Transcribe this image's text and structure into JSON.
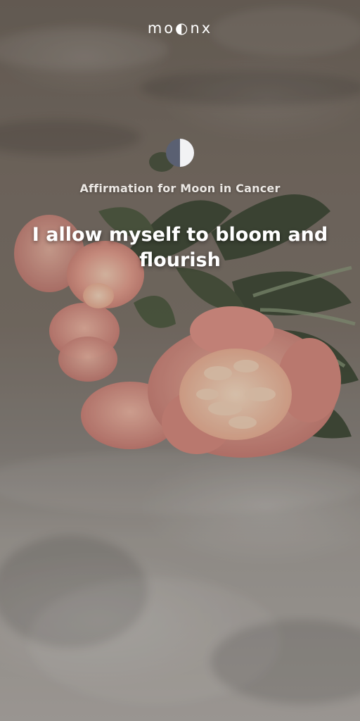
{
  "app": {
    "brand_name": "mo◐nx"
  },
  "header": {
    "moon_phase_icon": "half-moon-icon"
  },
  "content": {
    "subtitle": "Affirmation for Moon in Cancer",
    "affirmation": "I allow myself to bloom and flourish"
  },
  "background": {
    "subject": "peony-bouquet-on-linen-photo",
    "colors": {
      "linen": "#8a8580",
      "peony": "#e79a8c",
      "peony_center": "#f3c2a3",
      "leaf": "#3d4a35",
      "overlay": "#28221e"
    }
  },
  "colors": {
    "text_primary": "#ffffff",
    "text_secondary": "#ece8e4",
    "moon_light": "#f2f2f4",
    "moon_dark": "#5a6072"
  }
}
